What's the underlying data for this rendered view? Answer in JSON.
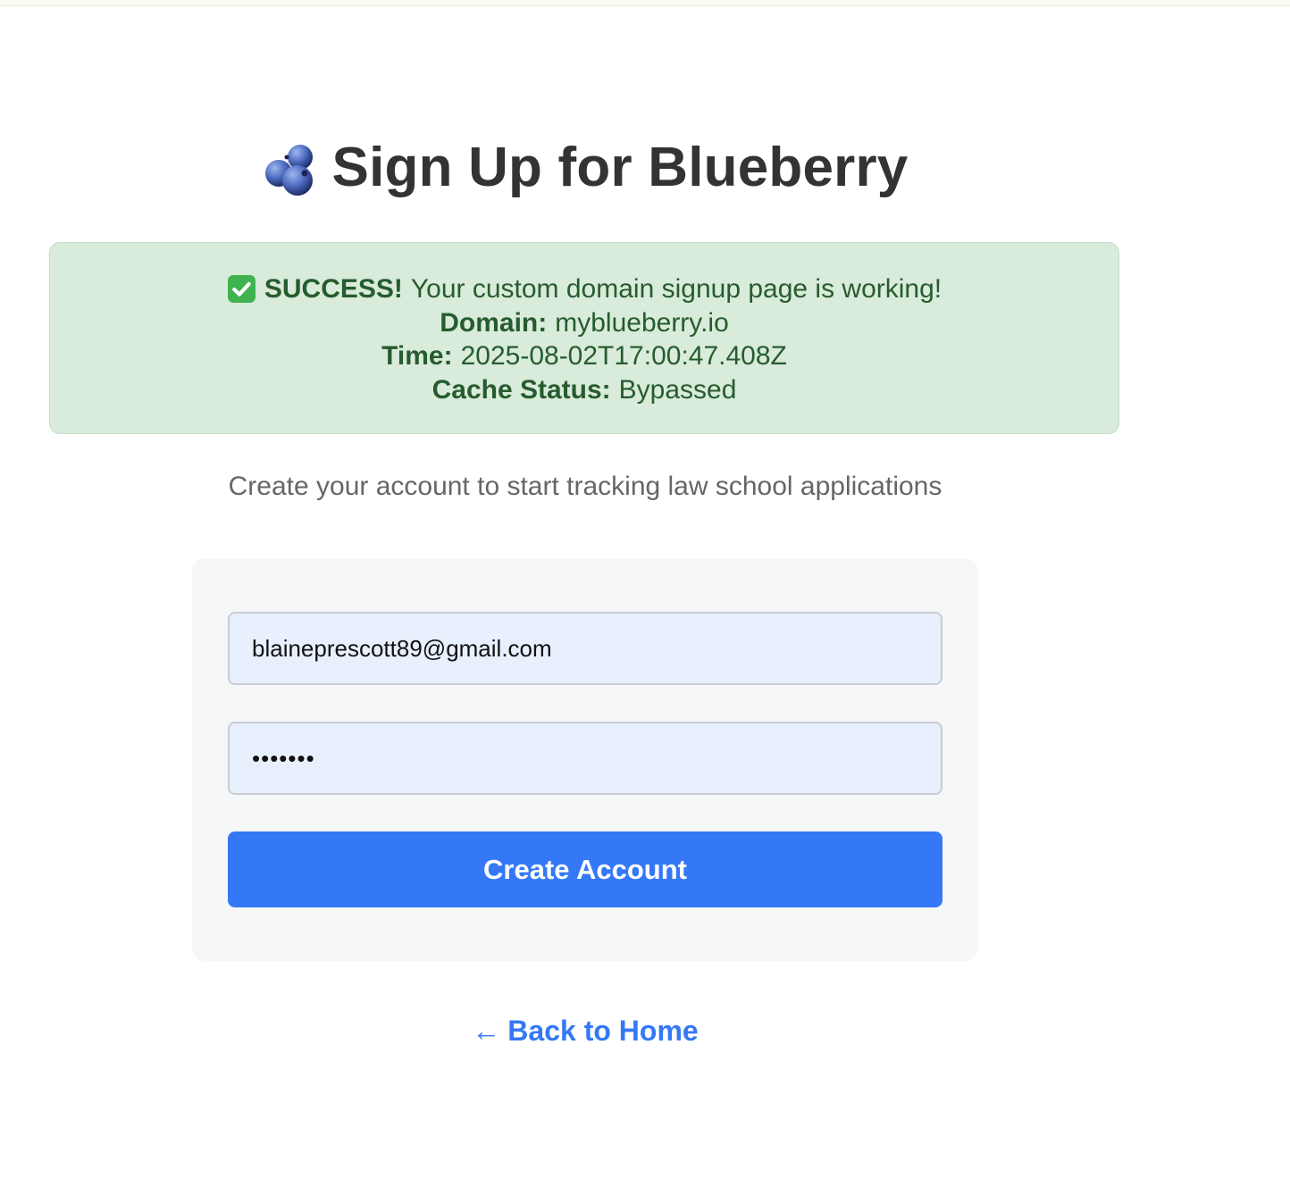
{
  "header": {
    "title": "Sign Up for Blueberry",
    "logo_icon": "blueberry-icon"
  },
  "success": {
    "icon": "check-mark-icon",
    "heading": "SUCCESS!",
    "message": "Your custom domain signup page is working!",
    "domain_label": "Domain:",
    "domain_value": "myblueberry.io",
    "time_label": "Time:",
    "time_value": "2025-08-02T17:00:47.408Z",
    "cache_label": "Cache Status:",
    "cache_value": "Bypassed",
    "background_color": "#d9ebdb",
    "text_color": "#265c2e"
  },
  "subtitle": "Create your account to start tracking law school applications",
  "form": {
    "email_value": "blaineprescott89@gmail.com",
    "password_value": "1234567",
    "submit_label": "Create Account",
    "accent_color": "#3478f6"
  },
  "footer": {
    "back_arrow": "←",
    "back_label": "Back to Home"
  }
}
